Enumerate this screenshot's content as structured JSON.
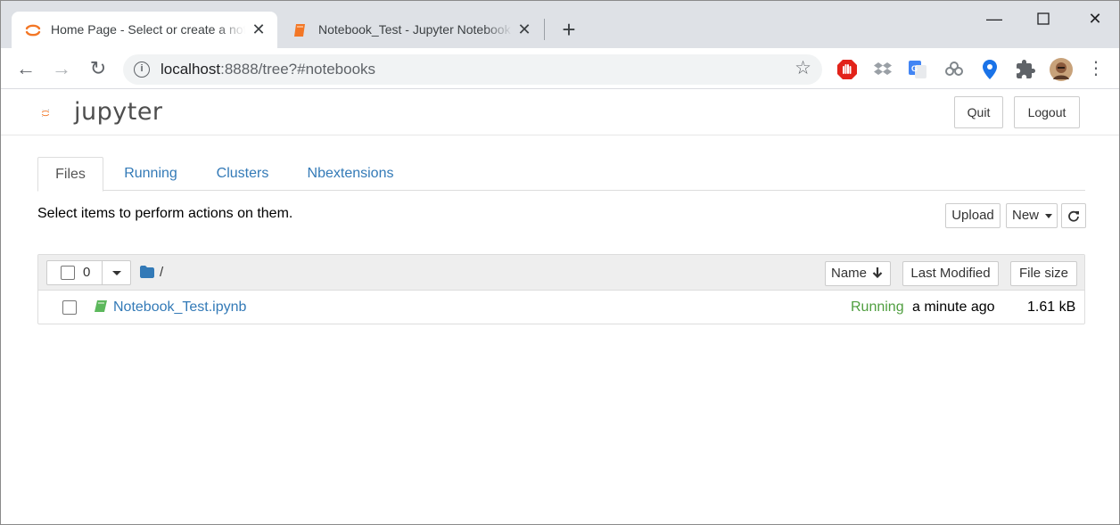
{
  "browser": {
    "tabs": [
      {
        "title": "Home Page - Select or create a notebook",
        "close_icon": "close-icon"
      },
      {
        "title": "Notebook_Test - Jupyter Notebook",
        "close_icon": "close-icon"
      }
    ],
    "new_tab": "+",
    "window_controls": {
      "minimize": "—",
      "maximize": "☐",
      "close": "✕"
    },
    "nav": {
      "back": "←",
      "forward": "→",
      "reload": "↻"
    },
    "url": {
      "host": "localhost",
      "rest": ":8888/tree?#notebooks"
    },
    "bookmark_star": "☆",
    "menu": "⋮"
  },
  "jupyter": {
    "logo_text": "jupyter",
    "quit_label": "Quit",
    "logout_label": "Logout",
    "tabs": [
      {
        "label": "Files",
        "active": true
      },
      {
        "label": "Running",
        "active": false
      },
      {
        "label": "Clusters",
        "active": false
      },
      {
        "label": "Nbextensions",
        "active": false
      }
    ],
    "instruction": "Select items to perform actions on them.",
    "upload_label": "Upload",
    "new_label": "New",
    "list": {
      "selected_count": "0",
      "breadcrumb": "/",
      "sort_name": "Name",
      "sort_modified": "Last Modified",
      "sort_size": "File size",
      "rows": [
        {
          "name": "Notebook_Test.ipynb",
          "status": "Running",
          "modified": "a minute ago",
          "size": "1.61 kB"
        }
      ]
    }
  },
  "colors": {
    "link": "#337ab7",
    "running": "#4f9e3f",
    "jupyter_orange": "#f37726"
  }
}
